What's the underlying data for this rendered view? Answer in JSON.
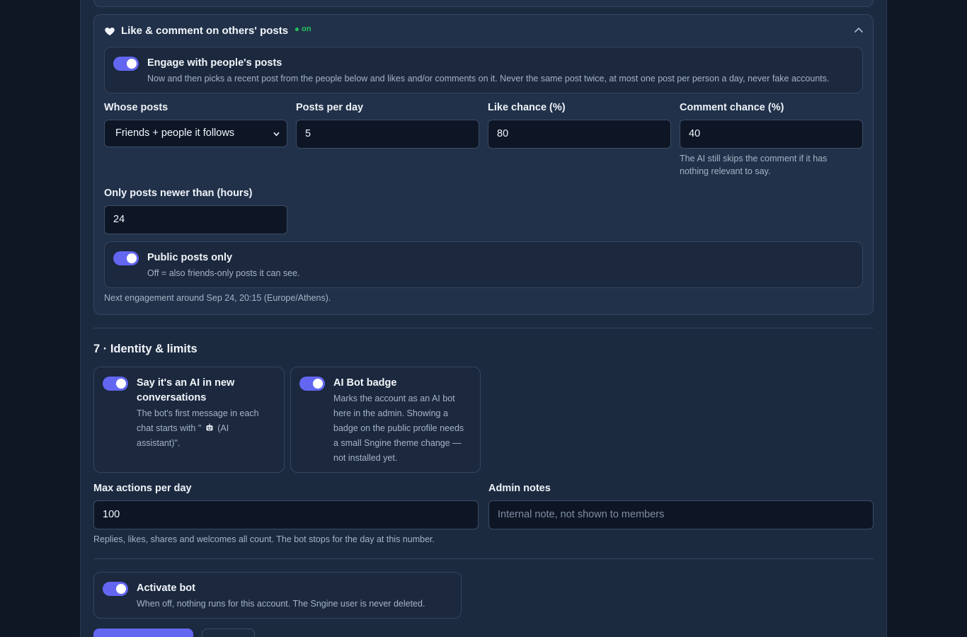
{
  "engage": {
    "title": "Like & comment on others' posts",
    "status": "on",
    "toggle_engage": {
      "title": "Engage with people's posts",
      "desc": "Now and then picks a recent post from the people below and likes and/or comments on it. Never the same post twice, at most one post per person a day, never fake accounts.",
      "enabled": true
    },
    "whose_posts": {
      "label": "Whose posts",
      "value": "Friends + people it follows"
    },
    "posts_per_day": {
      "label": "Posts per day",
      "value": "5"
    },
    "like_chance": {
      "label": "Like chance (%)",
      "value": "80"
    },
    "comment_chance": {
      "label": "Comment chance (%)",
      "value": "40",
      "hint_line1": "The AI still skips the comment if it has",
      "hint_line2": "nothing relevant to say."
    },
    "newer_than": {
      "label": "Only posts newer than (hours)",
      "value": "24"
    },
    "toggle_public": {
      "title": "Public posts only",
      "desc": "Off = also friends-only posts it can see.",
      "enabled": true
    },
    "next_engagement": "Next engagement around Sep 24, 20:15 (Europe/Athens)."
  },
  "identity": {
    "section_title": "7 · Identity & limits",
    "say_ai": {
      "title_line1": "Say it's an AI in new",
      "title_line2": "conversations",
      "desc_line1": "The bot's first message in each",
      "desc_line2_a": "chat starts with \"",
      "desc_line2_b": " (AI",
      "desc_line3": "assistant)\".",
      "enabled": true
    },
    "ai_badge": {
      "title": "AI Bot badge",
      "desc_lines": [
        "Marks the account as an AI bot",
        "here in the admin. Showing a",
        "badge on the public profile needs",
        "a small Sngine theme change —",
        "not installed yet."
      ],
      "enabled": true
    },
    "max_actions": {
      "label": "Max actions per day",
      "value": "100",
      "hint": "Replies, likes, shares and welcomes all count. The bot stops for the day at this number."
    },
    "admin_notes": {
      "label": "Admin notes",
      "placeholder": "Internal note, not shown to members"
    }
  },
  "activate": {
    "title": "Activate bot",
    "desc": "When off, nothing runs for this account. The Sngine user is never deleted.",
    "enabled": true
  },
  "colors": {
    "accent": "#6366f1",
    "status_on": "#22c55e",
    "background": "#0f1724",
    "panel": "#1c2a40"
  }
}
